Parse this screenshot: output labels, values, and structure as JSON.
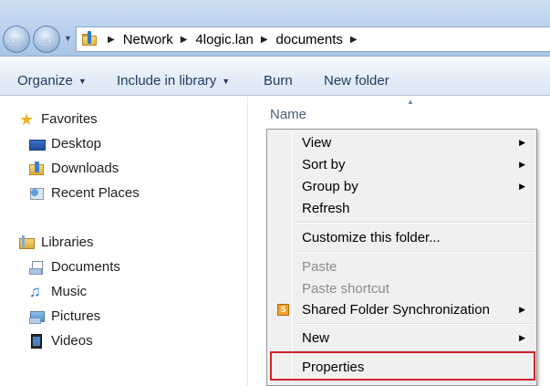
{
  "address_bar": {
    "breadcrumbs": [
      "Network",
      "4logic.lan",
      "documents"
    ],
    "back_icon": "back-arrow-icon",
    "forward_icon": "forward-arrow-icon"
  },
  "toolbar": {
    "organize": "Organize",
    "include_in_library": "Include in library",
    "burn": "Burn",
    "new_folder": "New folder"
  },
  "navigation": {
    "favorites": {
      "label": "Favorites",
      "items": [
        "Desktop",
        "Downloads",
        "Recent Places"
      ]
    },
    "libraries": {
      "label": "Libraries",
      "items": [
        "Documents",
        "Music",
        "Pictures",
        "Videos"
      ]
    }
  },
  "main": {
    "column_name": "Name"
  },
  "context_menu": {
    "items": [
      {
        "label": "View",
        "submenu": true,
        "disabled": false
      },
      {
        "label": "Sort by",
        "submenu": true,
        "disabled": false
      },
      {
        "label": "Group by",
        "submenu": true,
        "disabled": false
      },
      {
        "label": "Refresh",
        "submenu": false,
        "disabled": false
      },
      {
        "label": "Customize this folder...",
        "submenu": false,
        "disabled": false
      },
      {
        "label": "Paste",
        "submenu": false,
        "disabled": true
      },
      {
        "label": "Paste shortcut",
        "submenu": false,
        "disabled": true
      },
      {
        "label": "Shared Folder Synchronization",
        "submenu": true,
        "disabled": false
      },
      {
        "label": "New",
        "submenu": true,
        "disabled": false
      },
      {
        "label": "Properties",
        "submenu": false,
        "disabled": false
      }
    ],
    "highlighted_item": "Properties",
    "highlight_color": "#d1232a"
  }
}
